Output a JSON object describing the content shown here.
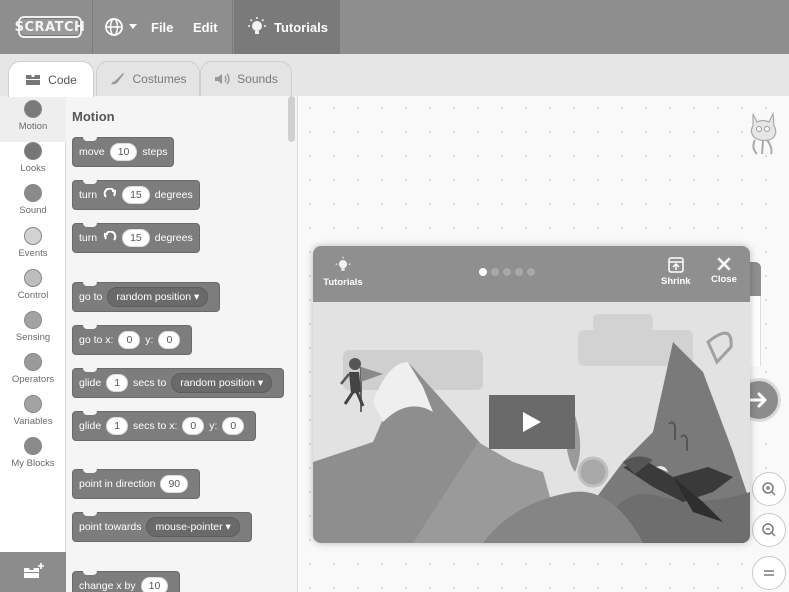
{
  "menubar": {
    "logo_text": "SCRATCH",
    "globe_icon": "globe-icon",
    "file_label": "File",
    "edit_label": "Edit",
    "tutorials_label": "Tutorials"
  },
  "tabs": [
    {
      "label": "Code",
      "icon": "code-icon"
    },
    {
      "label": "Costumes",
      "icon": "brush-icon"
    },
    {
      "label": "Sounds",
      "icon": "speaker-icon"
    }
  ],
  "categories": [
    {
      "label": "Motion",
      "color": "#7a7a7a"
    },
    {
      "label": "Looks",
      "color": "#767676"
    },
    {
      "label": "Sound",
      "color": "#8a8a8a"
    },
    {
      "label": "Events",
      "color": "#d2d2d2"
    },
    {
      "label": "Control",
      "color": "#bdbdbd"
    },
    {
      "label": "Sensing",
      "color": "#a2a2a2"
    },
    {
      "label": "Operators",
      "color": "#9a9a9a"
    },
    {
      "label": "Variables",
      "color": "#a3a3a3"
    },
    {
      "label": "My Blocks",
      "color": "#8a8a8a"
    }
  ],
  "palette": {
    "title": "Motion",
    "blocks": {
      "move": {
        "a": "move",
        "v1": "10",
        "b": "steps"
      },
      "turn_right": {
        "a": "turn",
        "v1": "15",
        "b": "degrees"
      },
      "turn_left": {
        "a": "turn",
        "v1": "15",
        "b": "degrees"
      },
      "goto": {
        "a": "go to",
        "dd": "random position ▾"
      },
      "gotoxy": {
        "a": "go to x:",
        "v1": "0",
        "b": "y:",
        "v2": "0"
      },
      "glide_random": {
        "a": "glide",
        "v1": "1",
        "b": "secs to",
        "dd": "random position ▾"
      },
      "glide_xy": {
        "a": "glide",
        "v1": "1",
        "b": "secs to x:",
        "v2": "0",
        "c": "y:",
        "v3": "0"
      },
      "point_dir": {
        "a": "point in direction",
        "v1": "90"
      },
      "point_towards": {
        "a": "point towards",
        "dd": "mouse-pointer ▾"
      },
      "change_x": {
        "a": "change x by",
        "v1": "10"
      }
    }
  },
  "tutorial_card": {
    "tutorials_label": "Tutorials",
    "shrink_label": "Shrink",
    "close_label": "Close",
    "dots_total": 5,
    "dots_active": 1
  },
  "colors": {
    "menubar": "#8e8e8e",
    "block": "#7d7d7d"
  }
}
